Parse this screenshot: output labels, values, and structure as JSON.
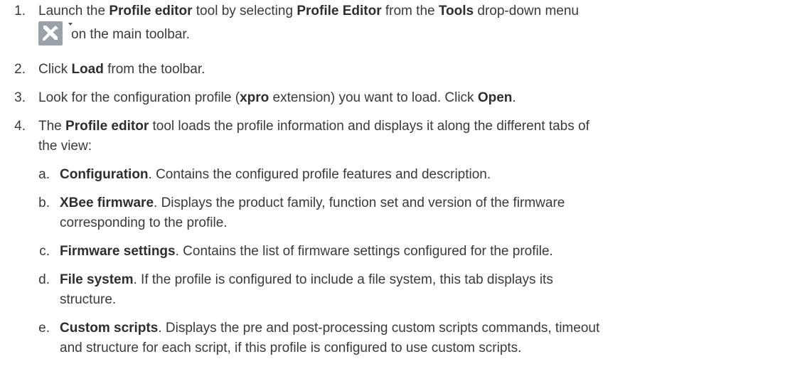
{
  "steps": [
    {
      "number": "1.",
      "parts": [
        "Launch the ",
        "Profile editor",
        " tool by selecting ",
        "Profile Editor",
        " from the ",
        "Tools",
        " drop-down menu",
        "on the main toolbar."
      ]
    },
    {
      "number": "2.",
      "parts": [
        "Click ",
        "Load",
        " from the toolbar."
      ]
    },
    {
      "number": "3.",
      "parts": [
        "Look for the configuration profile (",
        "xpro",
        " extension) you want to load. Click ",
        "Open",
        "."
      ]
    },
    {
      "number": "4.",
      "parts": [
        "The ",
        "Profile editor",
        " tool loads the profile information and displays it along the different tabs of",
        "the view:"
      ]
    }
  ],
  "tabs": [
    {
      "letter": "a.",
      "name": "Configuration",
      "desc": ". Contains the configured profile features and description."
    },
    {
      "letter": "b.",
      "name": "XBee firmware",
      "desc": ". Displays the product family, function set and version of the firmware",
      "desc2": "corresponding to the profile."
    },
    {
      "letter": "c.",
      "name": "Firmware settings",
      "desc": ". Contains the list of firmware settings configured for the profile."
    },
    {
      "letter": "d.",
      "name": "File system",
      "desc": ". If the profile is configured to include a file system, this tab displays its",
      "desc2": "structure."
    },
    {
      "letter": "e.",
      "name": "Custom scripts",
      "desc": ". Displays the pre and post-processing custom scripts commands, timeout",
      "desc2": "and structure for each script, if this profile is configured to use custom scripts."
    }
  ],
  "icons": {
    "tools": "tools-icon",
    "dropdown": "dropdown-arrow-icon"
  }
}
